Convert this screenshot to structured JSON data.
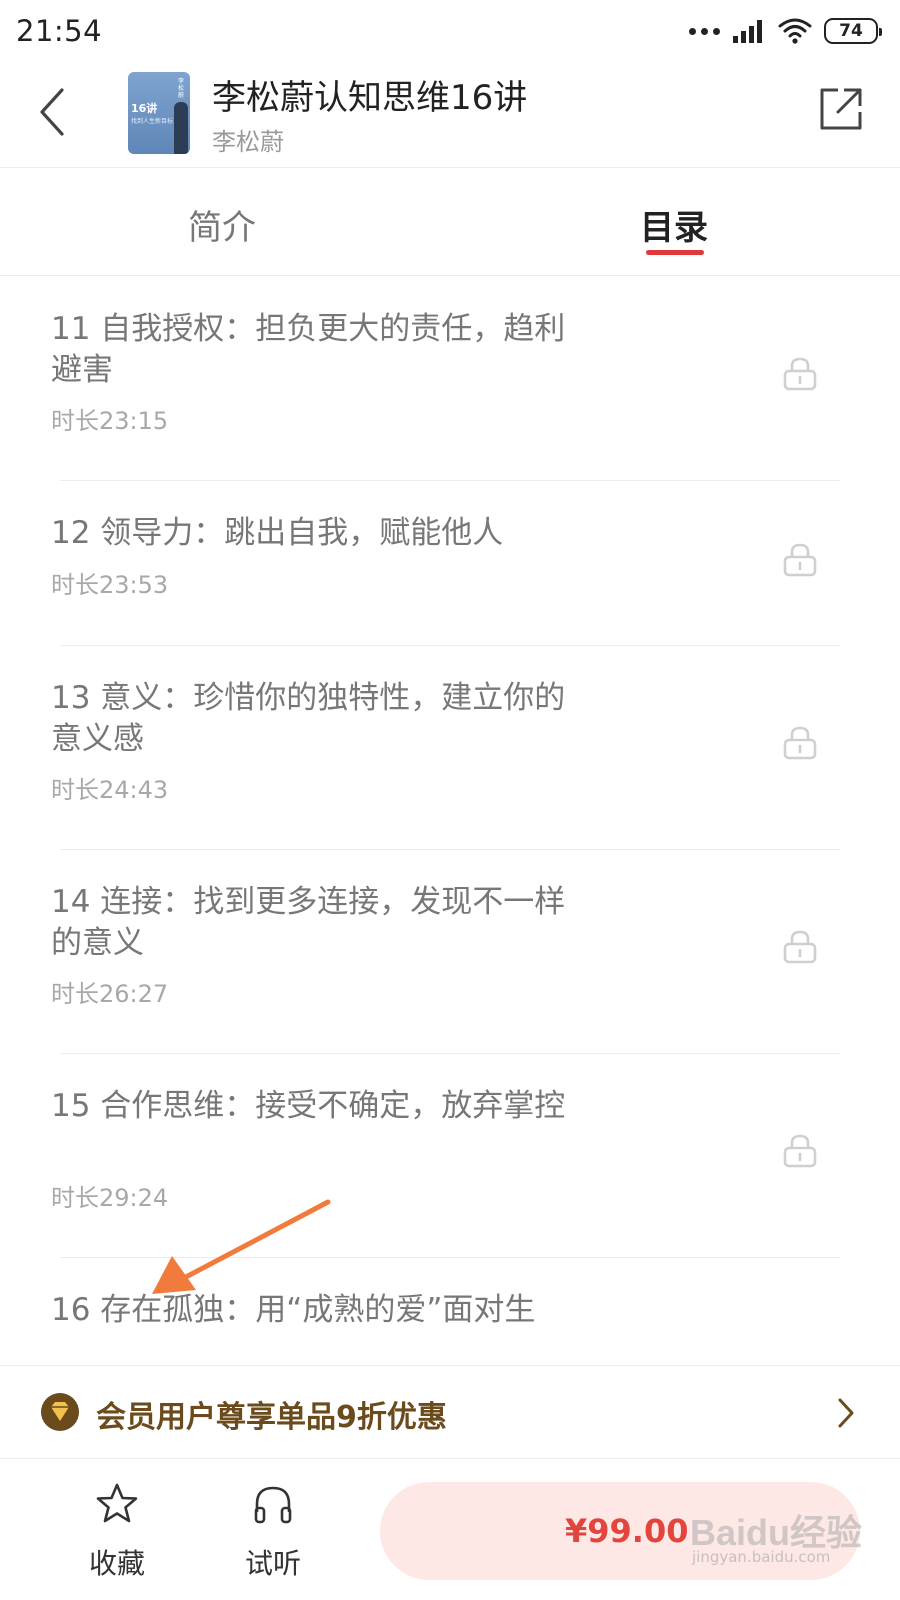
{
  "status_bar": {
    "time": "21:54",
    "battery": "74",
    "icons": [
      "dots-icon",
      "signal-icon",
      "wifi-icon",
      "battery-icon"
    ]
  },
  "header": {
    "back_icon": "back-chevron-icon",
    "title": "李松蔚认知思维16讲",
    "author": "李松蔚",
    "share_icon": "share-icon",
    "cover": {
      "big_text": "16讲",
      "small_text": "找到人生新目标",
      "vertical_text": "李松蔚",
      "color": "#6b93c4"
    }
  },
  "tabs": [
    {
      "label": "简介",
      "active": false
    },
    {
      "label": "目录",
      "active": true
    }
  ],
  "episodes": [
    {
      "title": "11 自我授权：担负更大的责任，趋利避害",
      "duration": "时长23:15",
      "locked": true
    },
    {
      "title": "12 领导力：跳出自我，赋能他人",
      "duration": "时长23:53",
      "locked": true
    },
    {
      "title": "13 意义：珍惜你的独特性，建立你的意义感",
      "duration": "时长24:43",
      "locked": true
    },
    {
      "title": "14 连接：找到更多连接，发现不一样的意义",
      "duration": "时长26:27",
      "locked": true
    },
    {
      "title": "15 合作思维：接受不确定，放弃掌控",
      "duration": "时长29:24",
      "locked": true
    },
    {
      "title": "16 存在孤独：用“成熟的爱”面对生",
      "duration": "",
      "locked": true
    }
  ],
  "member_banner": {
    "text": "会员用户尊享单品9折优惠",
    "icon": "member-diamond-icon"
  },
  "bottom_bar": {
    "favorite_label": "收藏",
    "listen_label": "试听",
    "price": "¥99.00"
  },
  "watermark": {
    "text": "Baidu经验",
    "url": "jingyan.baidu.com"
  },
  "colors": {
    "accent": "#e5383b",
    "price": "#e2453e",
    "buy_bg": "#fde8e6",
    "member_text": "#6b4a1c",
    "annotation_arrow": "#f07b3c"
  }
}
